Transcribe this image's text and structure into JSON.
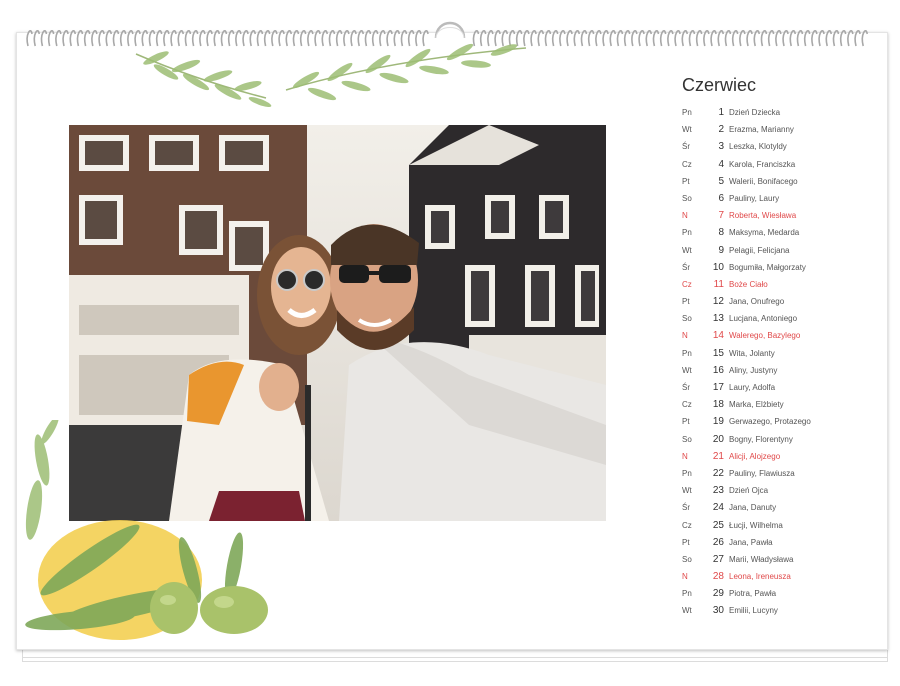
{
  "month": "Czerwiec",
  "days": [
    {
      "dow": "Pn",
      "day": "1",
      "names": "Dzień Dziecka",
      "holiday": false
    },
    {
      "dow": "Wt",
      "day": "2",
      "names": "Erazma, Marianny",
      "holiday": false
    },
    {
      "dow": "Śr",
      "day": "3",
      "names": "Leszka, Klotyldy",
      "holiday": false
    },
    {
      "dow": "Cz",
      "day": "4",
      "names": "Karola, Franciszka",
      "holiday": false
    },
    {
      "dow": "Pt",
      "day": "5",
      "names": "Walerii, Bonifacego",
      "holiday": false
    },
    {
      "dow": "So",
      "day": "6",
      "names": "Pauliny, Laury",
      "holiday": false
    },
    {
      "dow": "N",
      "day": "7",
      "names": "Roberta, Wiesława",
      "holiday": true
    },
    {
      "dow": "Pn",
      "day": "8",
      "names": "Maksyma, Medarda",
      "holiday": false
    },
    {
      "dow": "Wt",
      "day": "9",
      "names": "Pelagii, Felicjana",
      "holiday": false
    },
    {
      "dow": "Śr",
      "day": "10",
      "names": "Bogumiła, Małgorzaty",
      "holiday": false
    },
    {
      "dow": "Cz",
      "day": "11",
      "names": "Boże Ciało",
      "holiday": true
    },
    {
      "dow": "Pt",
      "day": "12",
      "names": "Jana, Onufrego",
      "holiday": false
    },
    {
      "dow": "So",
      "day": "13",
      "names": "Lucjana, Antoniego",
      "holiday": false
    },
    {
      "dow": "N",
      "day": "14",
      "names": "Walerego, Bazylego",
      "holiday": true
    },
    {
      "dow": "Pn",
      "day": "15",
      "names": "Wita, Jolanty",
      "holiday": false
    },
    {
      "dow": "Wt",
      "day": "16",
      "names": "Aliny, Justyny",
      "holiday": false
    },
    {
      "dow": "Śr",
      "day": "17",
      "names": "Laury, Adolfa",
      "holiday": false
    },
    {
      "dow": "Cz",
      "day": "18",
      "names": "Marka, Elżbiety",
      "holiday": false
    },
    {
      "dow": "Pt",
      "day": "19",
      "names": "Gerwazego, Protazego",
      "holiday": false
    },
    {
      "dow": "So",
      "day": "20",
      "names": "Bogny, Florentyny",
      "holiday": false
    },
    {
      "dow": "N",
      "day": "21",
      "names": "Alicji, Alojzego",
      "holiday": true
    },
    {
      "dow": "Pn",
      "day": "22",
      "names": "Pauliny, Flawiusza",
      "holiday": false
    },
    {
      "dow": "Wt",
      "day": "23",
      "names": "Dzień Ojca",
      "holiday": false
    },
    {
      "dow": "Śr",
      "day": "24",
      "names": "Jana, Danuty",
      "holiday": false
    },
    {
      "dow": "Cz",
      "day": "25",
      "names": "Łucji, Wilhelma",
      "holiday": false
    },
    {
      "dow": "Pt",
      "day": "26",
      "names": "Jana, Pawła",
      "holiday": false
    },
    {
      "dow": "So",
      "day": "27",
      "names": "Marii, Władysława",
      "holiday": false
    },
    {
      "dow": "N",
      "day": "28",
      "names": "Leona, Ireneusza",
      "holiday": true
    },
    {
      "dow": "Pn",
      "day": "29",
      "names": "Piotra, Pawła",
      "holiday": false
    },
    {
      "dow": "Wt",
      "day": "30",
      "names": "Emilii, Lucyny",
      "holiday": false
    }
  ],
  "colors": {
    "holiday": "#e0494a",
    "text": "#333333",
    "leaf": "#8fb36a",
    "lemon": "#f3cf52",
    "olive": "#a9c26a"
  }
}
